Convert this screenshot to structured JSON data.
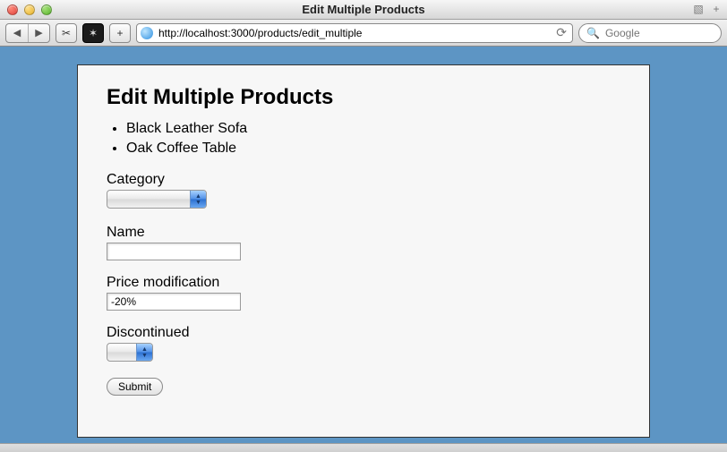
{
  "window": {
    "title": "Edit Multiple Products"
  },
  "address_bar": {
    "url": "http://localhost:3000/products/edit_multiple"
  },
  "search": {
    "placeholder": "Google"
  },
  "page": {
    "heading": "Edit Multiple Products",
    "items": [
      "Black Leather Sofa",
      "Oak Coffee Table"
    ],
    "fields": {
      "category": {
        "label": "Category",
        "selected": ""
      },
      "name": {
        "label": "Name",
        "value": ""
      },
      "price_modification": {
        "label": "Price modification",
        "value": "-20%"
      },
      "discontinued": {
        "label": "Discontinued",
        "selected": ""
      }
    },
    "submit_label": "Submit"
  }
}
